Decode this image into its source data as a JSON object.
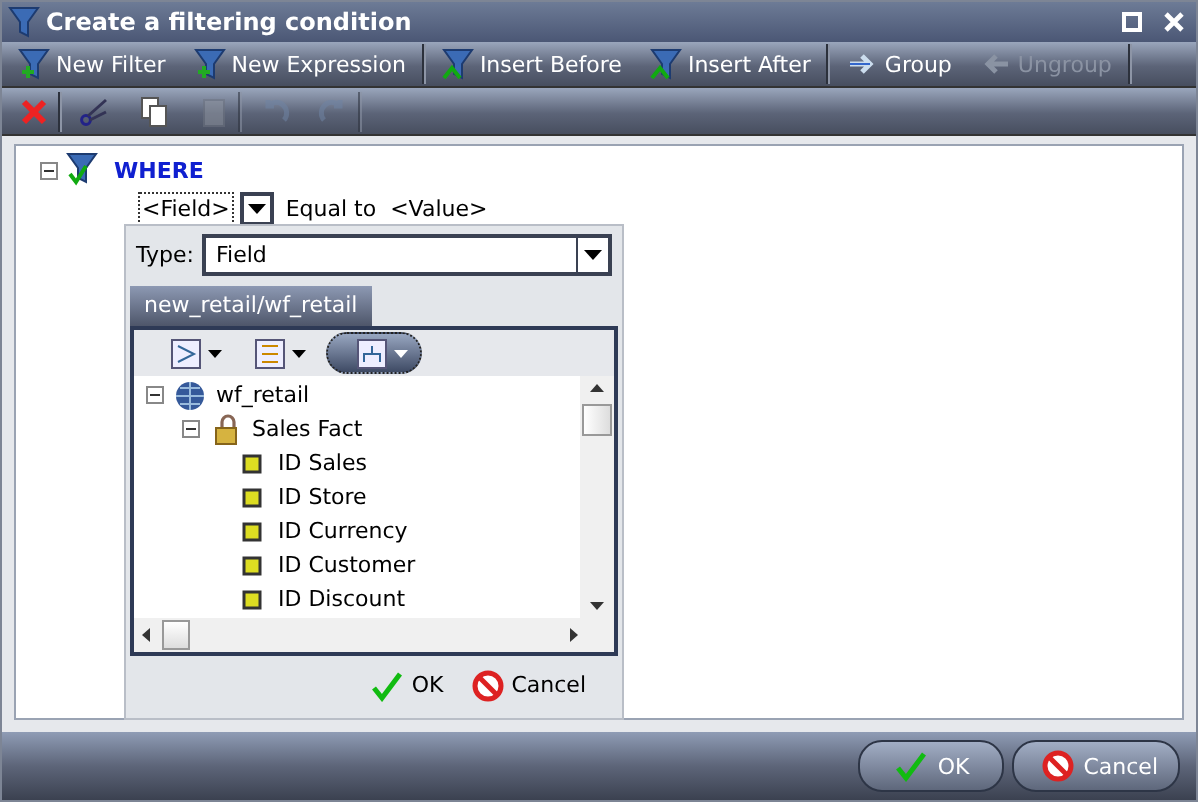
{
  "window": {
    "title": "Create a filtering condition"
  },
  "toolbar": [
    {
      "label": "New Filter",
      "kind": "new",
      "disabled": false,
      "separator_after": false
    },
    {
      "label": "New Expression",
      "kind": "new",
      "disabled": false,
      "separator_after": true
    },
    {
      "label": "Insert Before",
      "kind": "insert",
      "disabled": false,
      "separator_after": false
    },
    {
      "label": "Insert After",
      "kind": "insert",
      "disabled": false,
      "separator_after": true
    },
    {
      "label": "Group",
      "kind": "group",
      "disabled": false,
      "separator_after": false
    },
    {
      "label": "Ungroup",
      "kind": "ungroup",
      "disabled": true,
      "separator_after": true
    }
  ],
  "edit_toolbar": [
    {
      "kind": "delete",
      "disabled": false,
      "separator_after": true
    },
    {
      "kind": "cut",
      "disabled": false,
      "separator_after": false
    },
    {
      "kind": "copy",
      "disabled": false,
      "separator_after": false
    },
    {
      "kind": "paste",
      "disabled": true,
      "separator_after": true
    },
    {
      "kind": "undo",
      "disabled": true,
      "separator_after": false
    },
    {
      "kind": "redo",
      "disabled": true,
      "separator_after": true
    }
  ],
  "condition": {
    "root": "WHERE",
    "expanded": true,
    "field": "<Field>",
    "operator": "Equal to",
    "value": "<Value>"
  },
  "picker": {
    "type_label": "Type:",
    "type_value": "Field",
    "tab": "new_retail/wf_retail",
    "tree": [
      {
        "label": "wf_retail",
        "kind": "cube",
        "expanded": true,
        "children": [
          {
            "label": "Sales Fact",
            "kind": "lock",
            "expanded": true,
            "children": [
              {
                "label": "ID Sales",
                "kind": "field"
              },
              {
                "label": "ID Store",
                "kind": "field"
              },
              {
                "label": "ID Currency",
                "kind": "field"
              },
              {
                "label": "ID Customer",
                "kind": "field"
              },
              {
                "label": "ID Discount",
                "kind": "field"
              }
            ]
          }
        ]
      }
    ],
    "buttons": [
      "OK",
      "Cancel"
    ]
  },
  "buttons": [
    "OK",
    "Cancel"
  ]
}
